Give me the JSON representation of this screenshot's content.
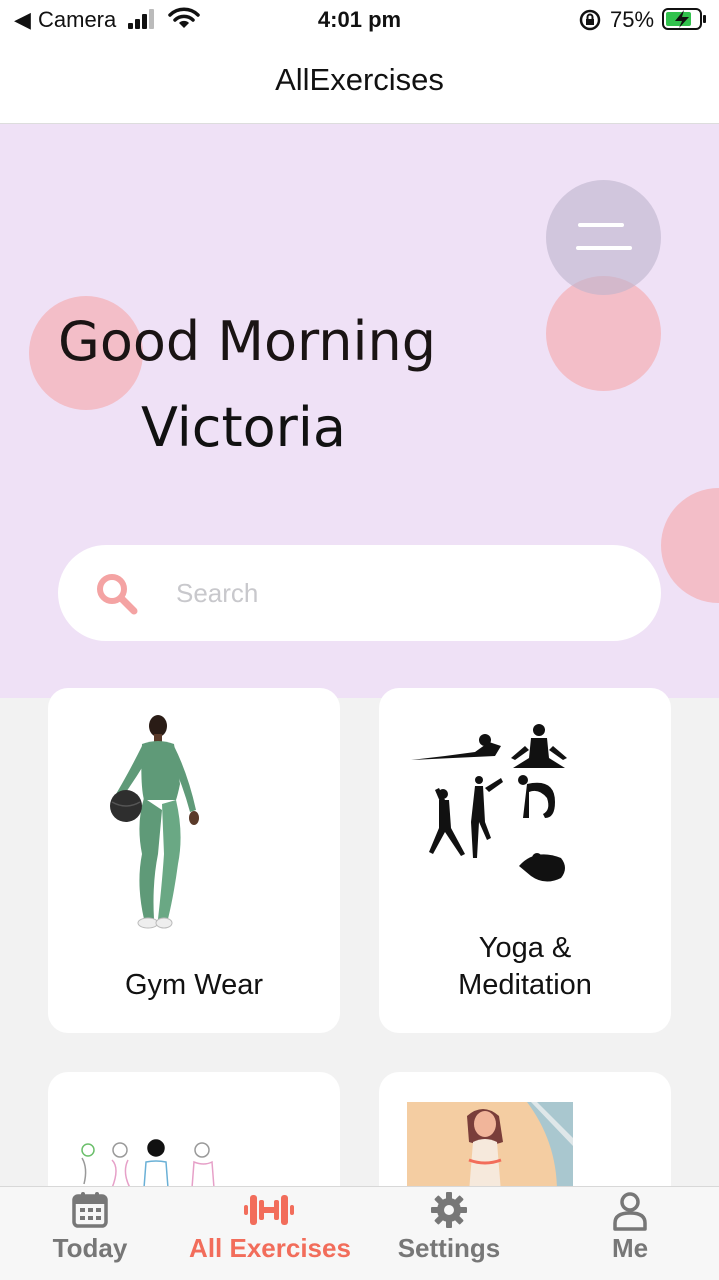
{
  "status_bar": {
    "back_app": "Camera",
    "time": "4:01 pm",
    "battery_percent": "75%"
  },
  "header": {
    "title": "AllExercises"
  },
  "hero": {
    "greeting_line1": "Good Morning",
    "greeting_line2": "Victoria",
    "menu_icon": "hamburger-menu-icon"
  },
  "search": {
    "placeholder": "Search",
    "value": "",
    "icon": "search-icon"
  },
  "categories": [
    {
      "label": "Gym Wear",
      "image": "green-gym-outfit-woman-with-ball"
    },
    {
      "label_line1": "Yoga &",
      "label_line2": "Meditation",
      "image": "yoga-silhouettes"
    },
    {
      "label": "",
      "image": "fashion-sketch-women"
    },
    {
      "label": "",
      "image": "meditating-woman-illustration"
    }
  ],
  "tabbar": {
    "items": [
      {
        "label": "Today",
        "icon": "calendar-icon",
        "active": false
      },
      {
        "label": "All Exercises",
        "icon": "dumbbell-icon",
        "active": true
      },
      {
        "label": "Settings",
        "icon": "gear-icon",
        "active": false
      },
      {
        "label": "Me",
        "icon": "person-icon",
        "active": false
      }
    ]
  },
  "colors": {
    "hero_bg": "#efe1f6",
    "bubble": "#f3bec8",
    "accent": "#f26d5b",
    "search_icon": "#f4a3a3",
    "battery_green": "#32c24d"
  }
}
